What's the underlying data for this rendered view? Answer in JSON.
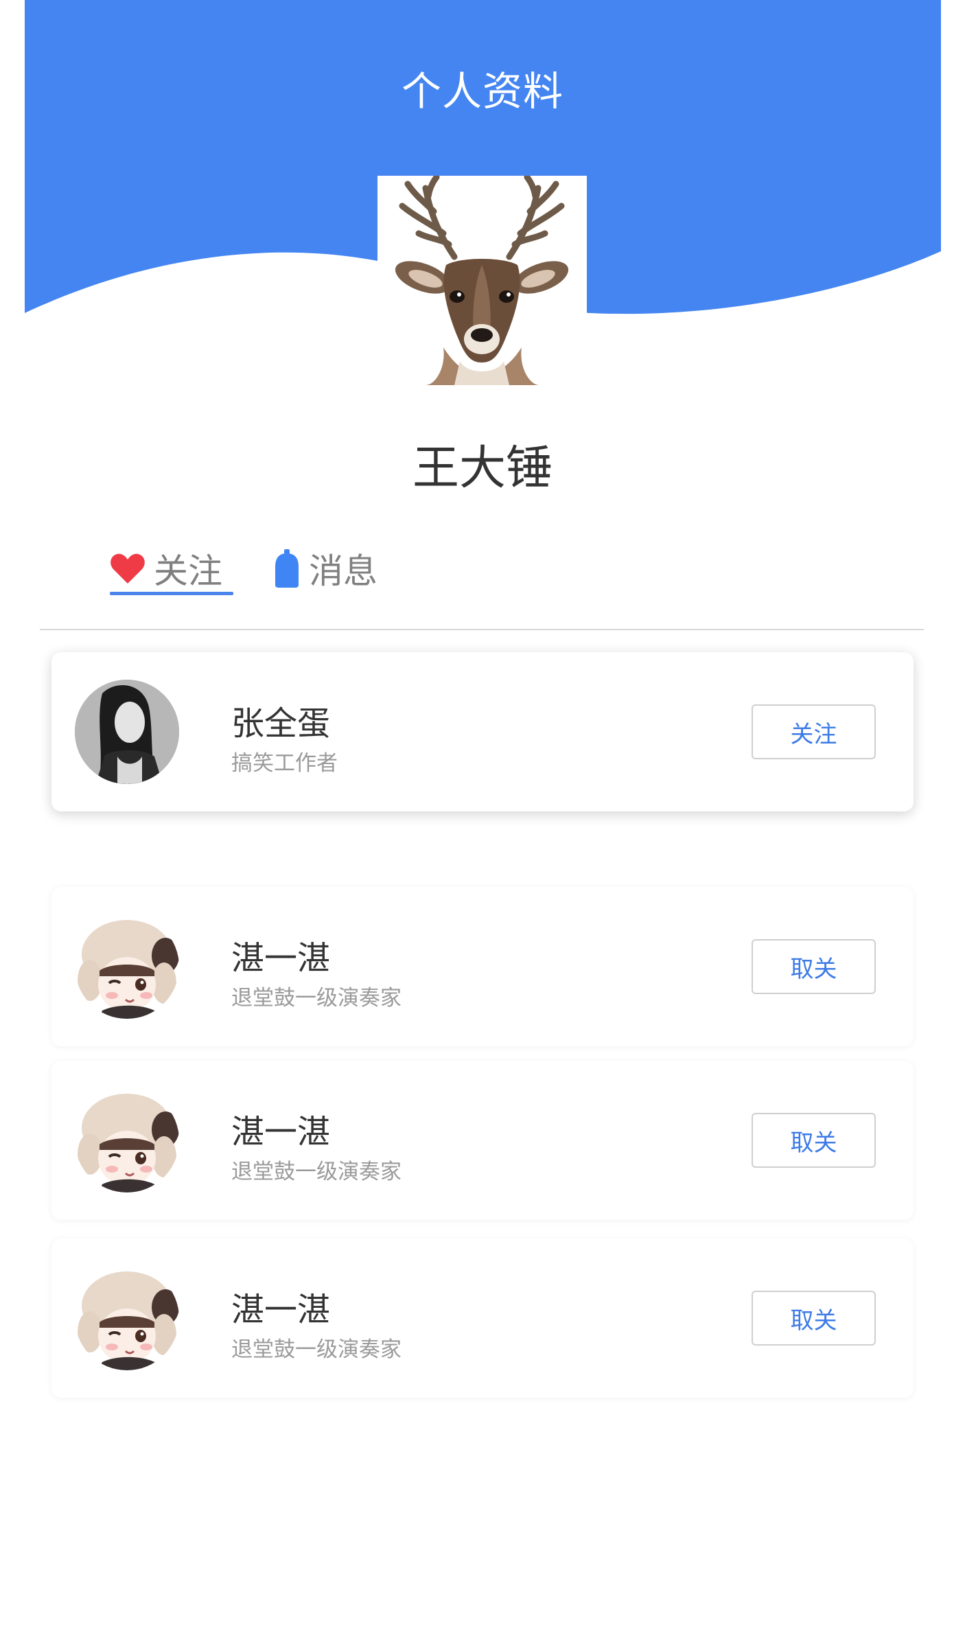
{
  "header": {
    "title": "个人资料",
    "background_color": "#4485f2"
  },
  "profile": {
    "name": "王大锤",
    "avatar": "deer-avatar"
  },
  "tabs": [
    {
      "label": "关注",
      "icon": "heart-icon",
      "icon_color": "#ef3b45",
      "active": true
    },
    {
      "label": "消息",
      "icon": "message-bubble-icon",
      "icon_color": "#3f86f4",
      "active": false
    }
  ],
  "users": [
    {
      "name": "张全蛋",
      "description": "搞笑工作者",
      "button": "关注",
      "avatar": "girl-photo-avatar"
    },
    {
      "name": "湛一湛",
      "description": "退堂鼓一级演奏家",
      "button": "取关",
      "avatar": "cartoon-girl-avatar"
    },
    {
      "name": "湛一湛",
      "description": "退堂鼓一级演奏家",
      "button": "取关",
      "avatar": "cartoon-girl-avatar"
    },
    {
      "name": "湛一湛",
      "description": "退堂鼓一级演奏家",
      "button": "取关",
      "avatar": "cartoon-girl-avatar"
    }
  ]
}
